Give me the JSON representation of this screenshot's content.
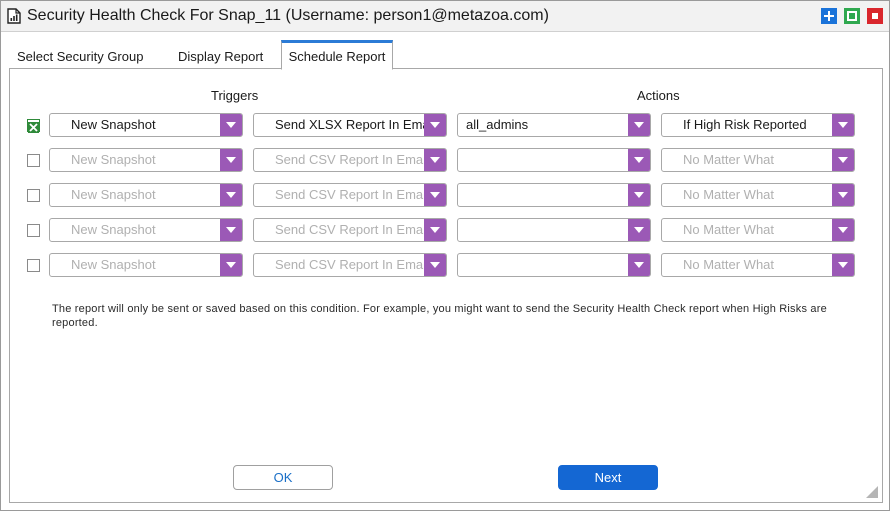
{
  "window": {
    "title": "Security Health Check For Snap_11 (Username: person1@metazoa.com)",
    "icon": "report-document-icon",
    "controls": [
      "maximize-plus-icon",
      "restore-square-icon",
      "close-square-icon"
    ]
  },
  "tabs": [
    {
      "label": "Select Security Group",
      "active": false
    },
    {
      "label": "Display Report",
      "active": false
    },
    {
      "label": "Schedule Report",
      "active": true
    }
  ],
  "headers": {
    "triggers": "Triggers",
    "actions": "Actions"
  },
  "rows": [
    {
      "checked": true,
      "trigger": "New Snapshot",
      "report": "Send XLSX Report In Email",
      "recipient": "all_admins",
      "condition": "If High Risk Reported",
      "enabled": true
    },
    {
      "checked": false,
      "trigger": "New Snapshot",
      "report": "Send CSV Report In Email",
      "recipient": "",
      "condition": "No Matter What",
      "enabled": false
    },
    {
      "checked": false,
      "trigger": "New Snapshot",
      "report": "Send CSV Report In Email",
      "recipient": "",
      "condition": "No Matter What",
      "enabled": false
    },
    {
      "checked": false,
      "trigger": "New Snapshot",
      "report": "Send CSV Report In Email",
      "recipient": "",
      "condition": "No Matter What",
      "enabled": false
    },
    {
      "checked": false,
      "trigger": "New Snapshot",
      "report": "Send CSV Report In Email",
      "recipient": "",
      "condition": "No Matter What",
      "enabled": false
    }
  ],
  "hint": "The report will only be sent or saved based on this condition. For example, you might want to send the Security Health Check report when High Risks are reported.",
  "buttons": {
    "ok": "OK",
    "next": "Next"
  },
  "colors": {
    "accent": "#9b59b6",
    "primary": "#1467d3",
    "tab_active": "#2b7bd6",
    "check": "#2f8a3a"
  }
}
